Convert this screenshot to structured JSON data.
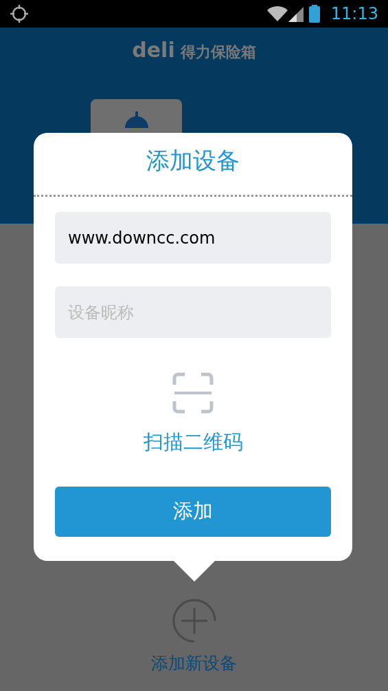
{
  "status_bar": {
    "time": "11:13"
  },
  "header": {
    "logo": "deli",
    "title": "得力保险箱"
  },
  "footer": {
    "add_label": "添加新设备"
  },
  "dialog": {
    "title": "添加设备",
    "fields": [
      {
        "value": "www.downcc.com"
      },
      {
        "placeholder": "设备昵称"
      }
    ],
    "scan_label": "扫描二维码",
    "button": "添加"
  }
}
